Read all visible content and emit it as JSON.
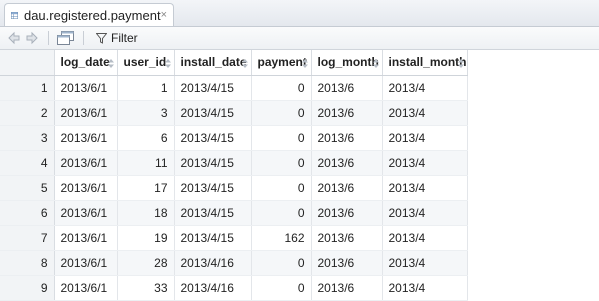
{
  "tab": {
    "title": "dau.registered.payment",
    "close_glyph": "×"
  },
  "toolbar": {
    "filter_label": "Filter"
  },
  "columns": [
    "log_date",
    "user_id",
    "install_date",
    "payment",
    "log_month",
    "install_month"
  ],
  "rows": [
    {
      "n": "1",
      "cells": [
        "2013/6/1",
        "1",
        "2013/4/15",
        "0",
        "2013/6",
        "2013/4"
      ]
    },
    {
      "n": "2",
      "cells": [
        "2013/6/1",
        "3",
        "2013/4/15",
        "0",
        "2013/6",
        "2013/4"
      ]
    },
    {
      "n": "3",
      "cells": [
        "2013/6/1",
        "6",
        "2013/4/15",
        "0",
        "2013/6",
        "2013/4"
      ]
    },
    {
      "n": "4",
      "cells": [
        "2013/6/1",
        "11",
        "2013/4/15",
        "0",
        "2013/6",
        "2013/4"
      ]
    },
    {
      "n": "5",
      "cells": [
        "2013/6/1",
        "17",
        "2013/4/15",
        "0",
        "2013/6",
        "2013/4"
      ]
    },
    {
      "n": "6",
      "cells": [
        "2013/6/1",
        "18",
        "2013/4/15",
        "0",
        "2013/6",
        "2013/4"
      ]
    },
    {
      "n": "7",
      "cells": [
        "2013/6/1",
        "19",
        "2013/4/15",
        "162",
        "2013/6",
        "2013/4"
      ]
    },
    {
      "n": "8",
      "cells": [
        "2013/6/1",
        "28",
        "2013/4/16",
        "0",
        "2013/6",
        "2013/4"
      ]
    },
    {
      "n": "9",
      "cells": [
        "2013/6/1",
        "33",
        "2013/4/16",
        "0",
        "2013/6",
        "2013/4"
      ]
    }
  ]
}
